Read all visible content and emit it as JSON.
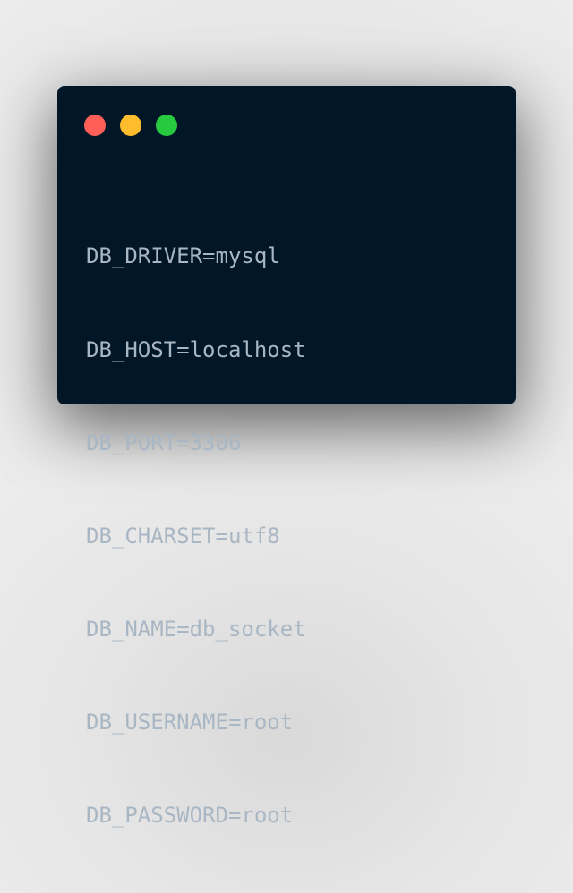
{
  "window": {
    "controls": [
      {
        "name": "close",
        "color": "#ff5f56"
      },
      {
        "name": "minimize",
        "color": "#ffbd2e"
      },
      {
        "name": "maximize",
        "color": "#27c93f"
      }
    ],
    "background": "#011627",
    "text_color": "#a9b6c3"
  },
  "code": {
    "lines": [
      "DB_DRIVER=mysql",
      "DB_HOST=localhost",
      "DB_PORT=3306",
      "DB_CHARSET=utf8",
      "DB_NAME=db_socket",
      "DB_USERNAME=root",
      "DB_PASSWORD=root"
    ]
  }
}
